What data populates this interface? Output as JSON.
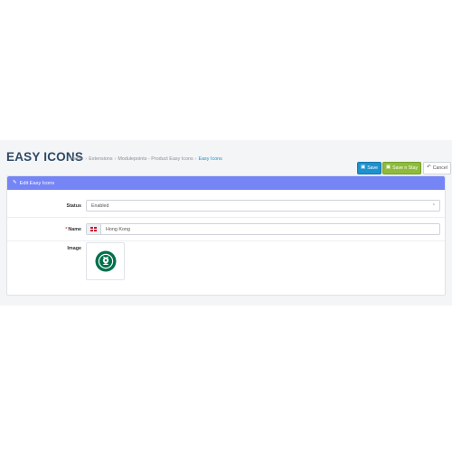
{
  "header": {
    "title": "EASY ICONS",
    "breadcrumb": [
      "Home",
      "Extensions",
      "Modulepoints - Product Easy Icons",
      "Easy Icons"
    ],
    "buttons": {
      "save": "Save",
      "save_stay": "Save n Stay",
      "cancel": "Cancel"
    }
  },
  "panel": {
    "heading": "Edit Easy Icons",
    "icon": "pencil-icon"
  },
  "form": {
    "status_label": "Status",
    "status_value": "Enabled",
    "name_label": "Name",
    "name_value": "Hong Kong",
    "image_label": "Image",
    "image_alt": "Starbucks Coffee logo"
  },
  "colors": {
    "save_button": "#1e91cf",
    "save_stay_button": "#8fbb3c",
    "panel_heading": "#7585f5",
    "title": "#2e4a67",
    "required_marker": "#d9534f"
  }
}
